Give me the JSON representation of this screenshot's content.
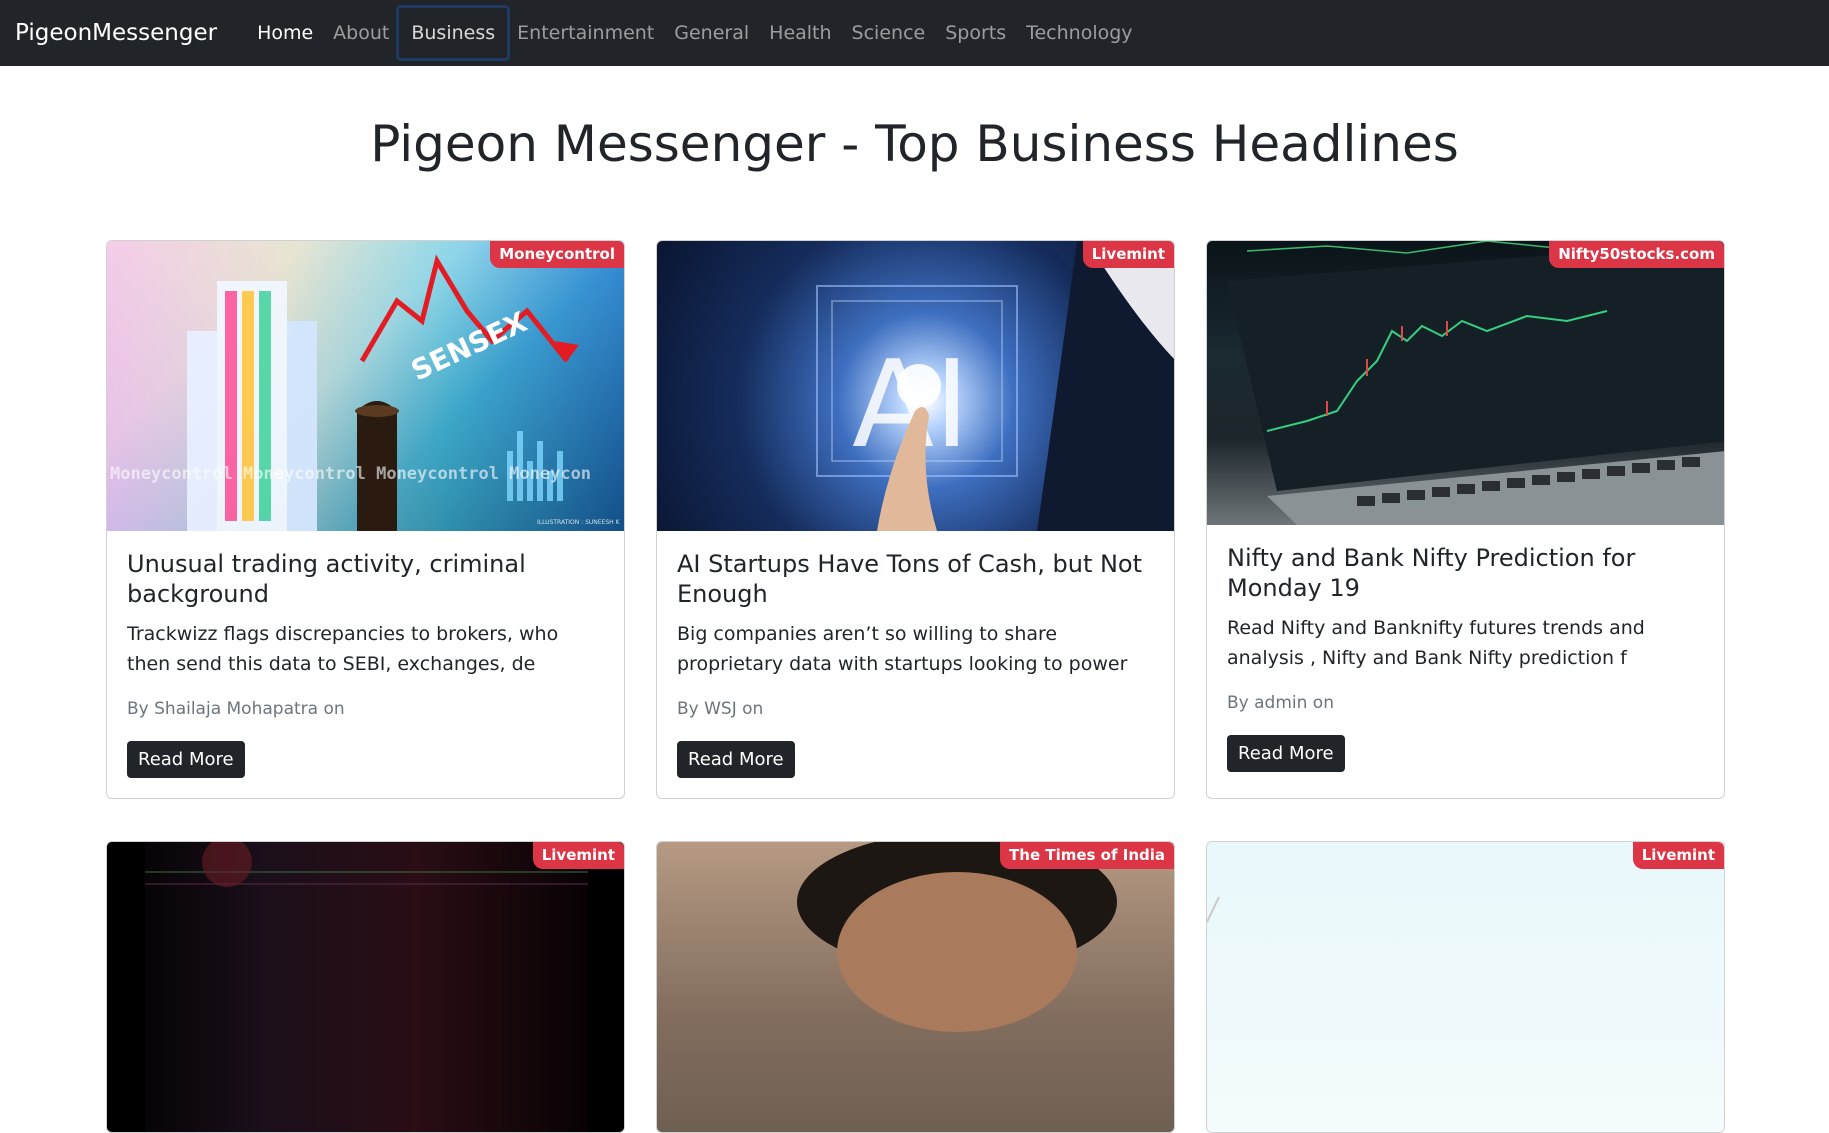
{
  "navbar": {
    "brand": "PigeonMessenger",
    "links": [
      {
        "label": "Home"
      },
      {
        "label": "About"
      },
      {
        "label": "Business"
      },
      {
        "label": "Entertainment"
      },
      {
        "label": "General"
      },
      {
        "label": "Health"
      },
      {
        "label": "Science"
      },
      {
        "label": "Sports"
      },
      {
        "label": "Technology"
      }
    ]
  },
  "page": {
    "title": "Pigeon Messenger - Top Business Headlines"
  },
  "articles": [
    {
      "source": "Moneycontrol",
      "title": "Unusual trading activity, criminal background",
      "description": "Trackwizz flags discrepancies to brokers, who then send this data to SEBI, exchanges, de",
      "meta": "By Shailaja Mohapatra on",
      "button": "Read More",
      "image_text": [
        "SENSEX",
        "Moneycontrol Moneycontrol Moneycontrol Moneycon",
        "ILLUSTRATION : SUNEESH K"
      ]
    },
    {
      "source": "Livemint",
      "title": "AI Startups Have Tons of Cash, but Not Enough",
      "description": "Big companies aren’t so willing to share proprietary data with startups looking to power",
      "meta": "By WSJ on",
      "button": "Read More",
      "image_text": [
        "AI"
      ]
    },
    {
      "source": "Nifty50stocks.com",
      "title": "Nifty and Bank Nifty Prediction for Monday 19",
      "description": "Read Nifty and Banknifty futures trends and analysis , Nifty and Bank Nifty prediction f",
      "meta": "By admin on",
      "button": "Read More"
    },
    {
      "source": "Livemint"
    },
    {
      "source": "The Times of India"
    },
    {
      "source": "Livemint"
    }
  ]
}
